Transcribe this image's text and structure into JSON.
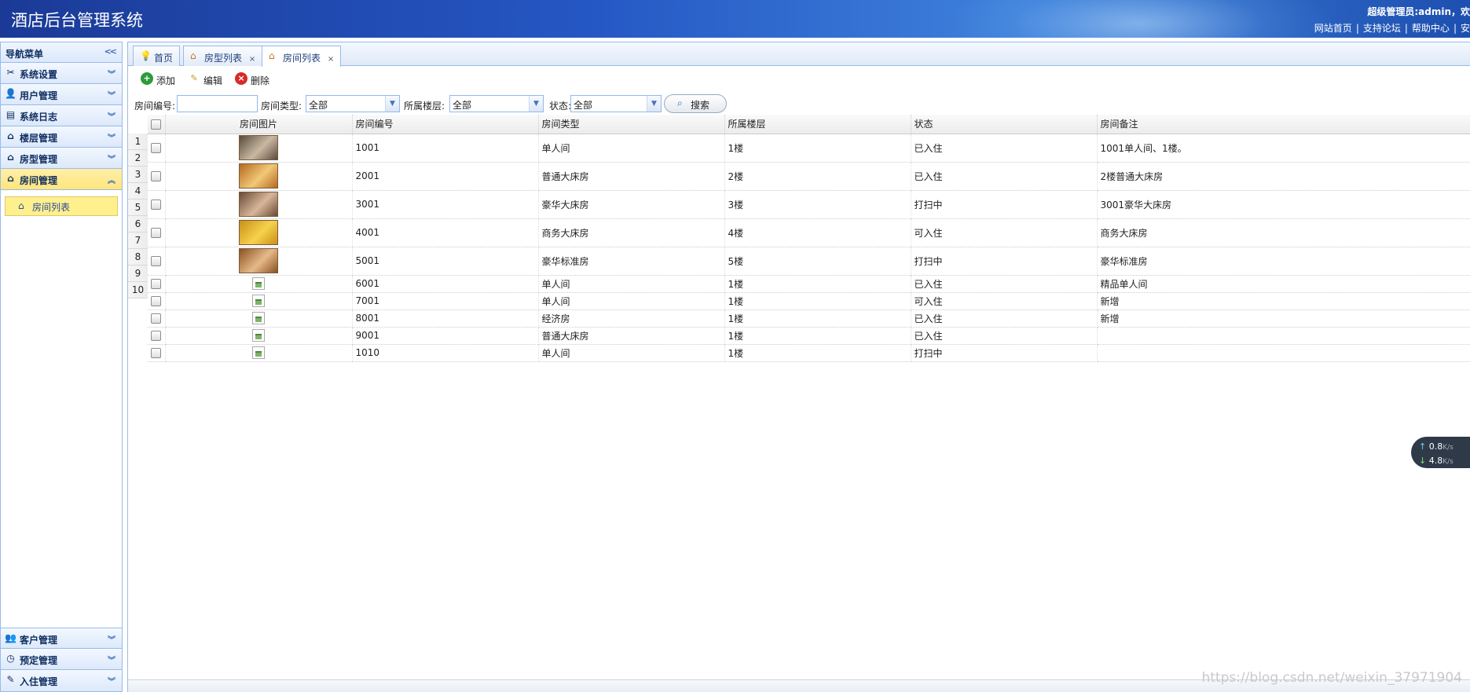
{
  "app": {
    "title": "酒店后台管理系统",
    "admin_line": "超级管理员:admin，欢",
    "links": [
      "网站首页",
      "支持论坛",
      "帮助中心",
      "安"
    ]
  },
  "sidebar": {
    "header": "导航菜单",
    "top_items": [
      {
        "label": "系统设置",
        "icon": "tools-icon"
      },
      {
        "label": "用户管理",
        "icon": "user-icon"
      },
      {
        "label": "系统日志",
        "icon": "log-icon"
      },
      {
        "label": "楼层管理",
        "icon": "home-icon"
      },
      {
        "label": "房型管理",
        "icon": "home-icon"
      },
      {
        "label": "房间管理",
        "icon": "home-icon",
        "active": true
      }
    ],
    "sub_items": [
      {
        "label": "房间列表",
        "icon": "home-icon"
      }
    ],
    "bottom_items": [
      {
        "label": "客户管理",
        "icon": "users-icon"
      },
      {
        "label": "预定管理",
        "icon": "clock-icon"
      },
      {
        "label": "入住管理",
        "icon": "checkin-icon"
      }
    ]
  },
  "tabs": [
    {
      "label": "首页",
      "icon": "bulb-icon",
      "closable": false
    },
    {
      "label": "房型列表",
      "icon": "home-icon",
      "closable": true
    },
    {
      "label": "房间列表",
      "icon": "home-icon",
      "closable": true,
      "active": true
    }
  ],
  "toolbar": {
    "add": "添加",
    "edit": "编辑",
    "delete": "删除"
  },
  "filters": {
    "room_no_label": "房间编号:",
    "room_no_value": "",
    "room_type_label": "房间类型:",
    "room_type_value": "全部",
    "floor_label": "所属楼层:",
    "floor_value": "全部",
    "status_label": "状态:",
    "status_value": "全部",
    "search": "搜索"
  },
  "grid": {
    "columns": [
      "房间图片",
      "房间编号",
      "房间类型",
      "所属楼层",
      "状态",
      "房间备注"
    ],
    "rows": [
      {
        "photo": "photo",
        "no": "1001",
        "type": "单人间",
        "floor": "1楼",
        "status": "已入住",
        "note": "1001单人间、1楼。"
      },
      {
        "photo": "photo",
        "no": "2001",
        "type": "普通大床房",
        "floor": "2楼",
        "status": "已入住",
        "note": "2楼普通大床房"
      },
      {
        "photo": "photo",
        "no": "3001",
        "type": "豪华大床房",
        "floor": "3楼",
        "status": "打扫中",
        "note": "3001豪华大床房"
      },
      {
        "photo": "photo",
        "no": "4001",
        "type": "商务大床房",
        "floor": "4楼",
        "status": "可入住",
        "note": "商务大床房"
      },
      {
        "photo": "photo",
        "no": "5001",
        "type": "豪华标准房",
        "floor": "5楼",
        "status": "打扫中",
        "note": "豪华标准房"
      },
      {
        "photo": "broken",
        "no": "6001",
        "type": "单人间",
        "floor": "1楼",
        "status": "已入住",
        "note": "精品单人间"
      },
      {
        "photo": "broken",
        "no": "7001",
        "type": "单人间",
        "floor": "1楼",
        "status": "可入住",
        "note": "新增"
      },
      {
        "photo": "broken",
        "no": "8001",
        "type": "经济房",
        "floor": "1楼",
        "status": "已入住",
        "note": "新增"
      },
      {
        "photo": "broken",
        "no": "9001",
        "type": "普通大床房",
        "floor": "1楼",
        "status": "已入住",
        "note": ""
      },
      {
        "photo": "broken",
        "no": "1010",
        "type": "单人间",
        "floor": "1楼",
        "status": "打扫中",
        "note": ""
      }
    ],
    "row_numbers": [
      "1",
      "2",
      "3",
      "4",
      "5",
      "6",
      "7",
      "8",
      "9",
      "10"
    ]
  },
  "net_speed": {
    "up": "0.8",
    "down": "4.8",
    "unit": "K/s"
  },
  "watermark": "https://blog.csdn.net/weixin_37971904",
  "colors": {
    "header": "#2557c4",
    "active_nav": "#ffe57c",
    "border": "#99bbe8"
  }
}
